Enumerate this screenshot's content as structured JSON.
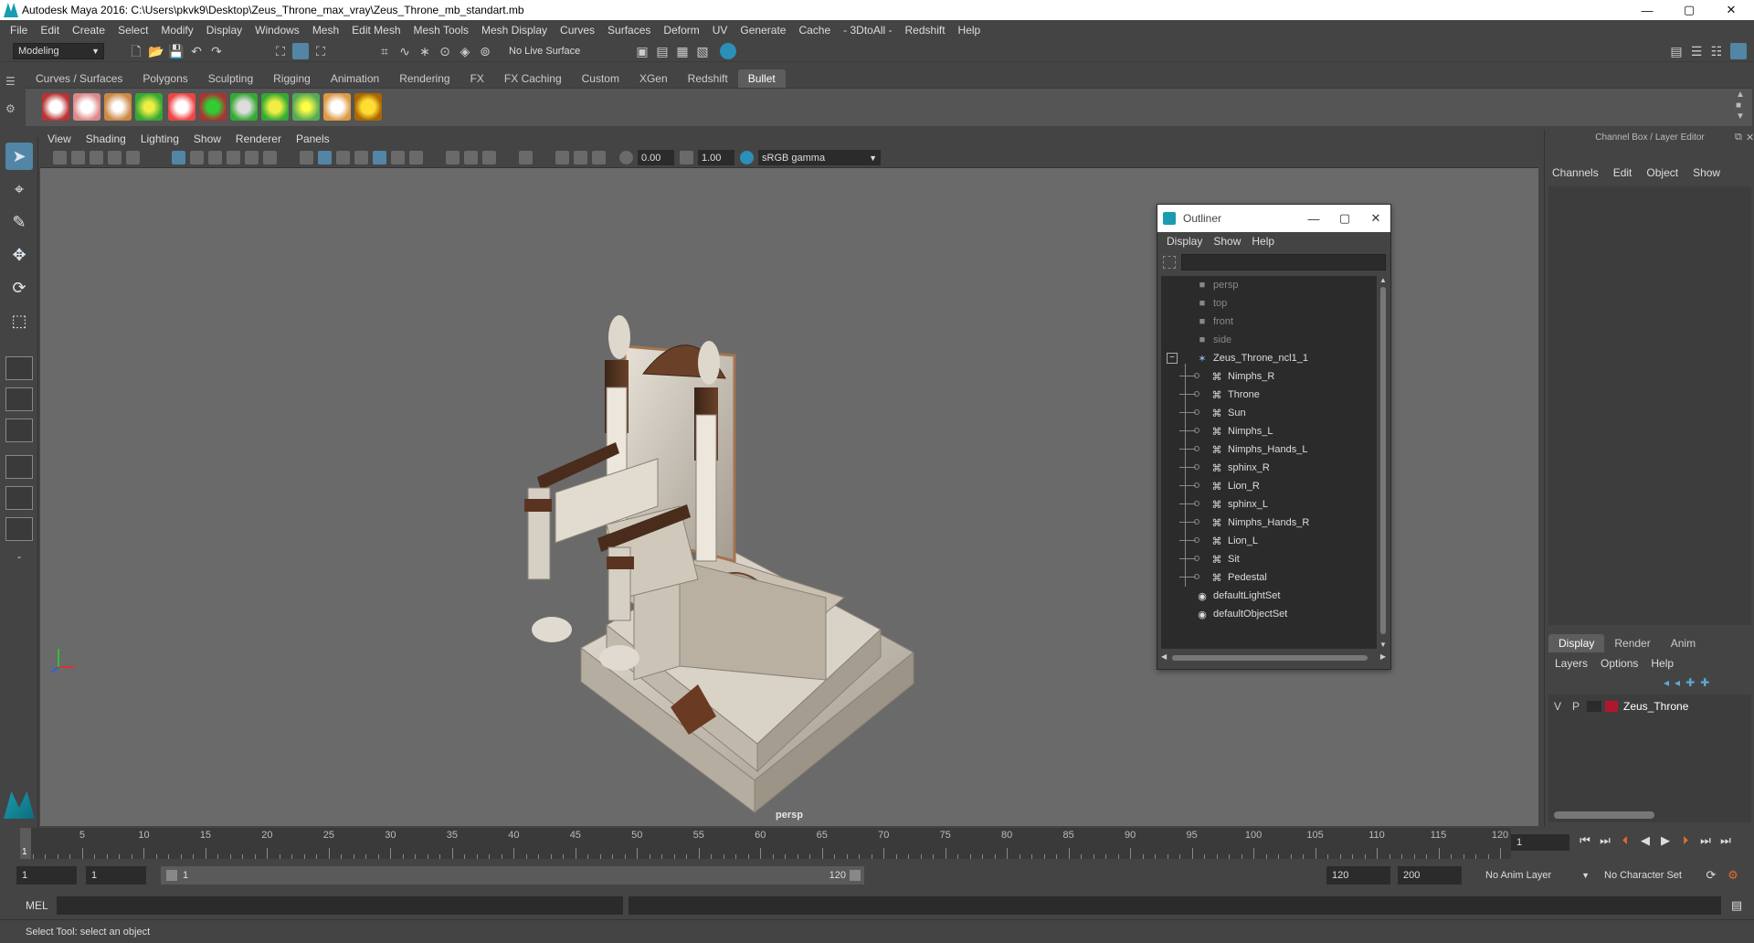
{
  "window": {
    "title": "Autodesk Maya 2016: C:\\Users\\pkvk9\\Desktop\\Zeus_Throne_max_vray\\Zeus_Throne_mb_standart.mb",
    "minimize": "—",
    "maximize": "▢",
    "close": "✕"
  },
  "menubar": [
    "File",
    "Edit",
    "Create",
    "Select",
    "Modify",
    "Display",
    "Windows",
    "Mesh",
    "Edit Mesh",
    "Mesh Tools",
    "Mesh Display",
    "Curves",
    "Surfaces",
    "Deform",
    "UV",
    "Generate",
    "Cache",
    "- 3DtoAll -",
    "Redshift",
    "Help"
  ],
  "statusline": {
    "mode": "Modeling",
    "live_surface": "No Live Surface"
  },
  "shelf": {
    "tabs": [
      "Curves / Surfaces",
      "Polygons",
      "Sculpting",
      "Rigging",
      "Animation",
      "Rendering",
      "FX",
      "FX Caching",
      "Custom",
      "XGen",
      "Redshift",
      "Bullet"
    ],
    "active_tab": "Bullet"
  },
  "viewport": {
    "menu": [
      "View",
      "Shading",
      "Lighting",
      "Show",
      "Renderer",
      "Panels"
    ],
    "exposure": "0.00",
    "gamma": "1.00",
    "color_space": "sRGB gamma",
    "camera_label": "persp"
  },
  "outliner": {
    "title": "Outliner",
    "menu": [
      "Display",
      "Show",
      "Help"
    ],
    "items": [
      {
        "label": "persp",
        "type": "camera",
        "indent": 0,
        "dim": true
      },
      {
        "label": "top",
        "type": "camera",
        "indent": 0,
        "dim": true
      },
      {
        "label": "front",
        "type": "camera",
        "indent": 0,
        "dim": true
      },
      {
        "label": "side",
        "type": "camera",
        "indent": 0,
        "dim": true
      },
      {
        "label": "Zeus_Throne_ncl1_1",
        "type": "group",
        "indent": 0,
        "dim": false
      },
      {
        "label": "Nimphs_R",
        "type": "mesh",
        "indent": 1,
        "dim": false
      },
      {
        "label": "Throne",
        "type": "mesh",
        "indent": 1,
        "dim": false
      },
      {
        "label": "Sun",
        "type": "mesh",
        "indent": 1,
        "dim": false
      },
      {
        "label": "Nimphs_L",
        "type": "mesh",
        "indent": 1,
        "dim": false
      },
      {
        "label": "Nimphs_Hands_L",
        "type": "mesh",
        "indent": 1,
        "dim": false
      },
      {
        "label": "sphinx_R",
        "type": "mesh",
        "indent": 1,
        "dim": false
      },
      {
        "label": "Lion_R",
        "type": "mesh",
        "indent": 1,
        "dim": false
      },
      {
        "label": "sphinx_L",
        "type": "mesh",
        "indent": 1,
        "dim": false
      },
      {
        "label": "Nimphs_Hands_R",
        "type": "mesh",
        "indent": 1,
        "dim": false
      },
      {
        "label": "Lion_L",
        "type": "mesh",
        "indent": 1,
        "dim": false
      },
      {
        "label": "Sit",
        "type": "mesh",
        "indent": 1,
        "dim": false
      },
      {
        "label": "Pedestal",
        "type": "mesh",
        "indent": 1,
        "dim": false
      },
      {
        "label": "defaultLightSet",
        "type": "set",
        "indent": 0,
        "dim": false
      },
      {
        "label": "defaultObjectSet",
        "type": "set",
        "indent": 0,
        "dim": false
      }
    ]
  },
  "channelbox": {
    "title": "Channel Box / Layer Editor",
    "menu": [
      "Channels",
      "Edit",
      "Object",
      "Show"
    ],
    "layer_tabs": [
      "Display",
      "Render",
      "Anim"
    ],
    "active_layer_tab": "Display",
    "layer_menu": [
      "Layers",
      "Options",
      "Help"
    ],
    "layer": {
      "v": "V",
      "p": "P",
      "name": "Zeus_Throne",
      "color": "#b0172f"
    }
  },
  "timeline": {
    "ticks": [
      "5",
      "10",
      "15",
      "20",
      "25",
      "30",
      "35",
      "40",
      "45",
      "50",
      "55",
      "60",
      "65",
      "70",
      "75",
      "80",
      "85",
      "90",
      "95",
      "100",
      "105",
      "110",
      "115",
      "120"
    ],
    "current_frame_marker": "1",
    "current_frame": "1"
  },
  "range": {
    "start": "1",
    "playback_start": "1",
    "slider_start": "1",
    "slider_end": "120",
    "playback_end": "120",
    "end": "200",
    "anim_layer": "No Anim Layer",
    "character_set": "No Character Set"
  },
  "command_line": {
    "label": "MEL"
  },
  "help_line": "Select Tool: select an object",
  "colors": {
    "accent": "#5285a6",
    "maya_teal": "#1a9cb0",
    "layer_red": "#b0172f"
  }
}
